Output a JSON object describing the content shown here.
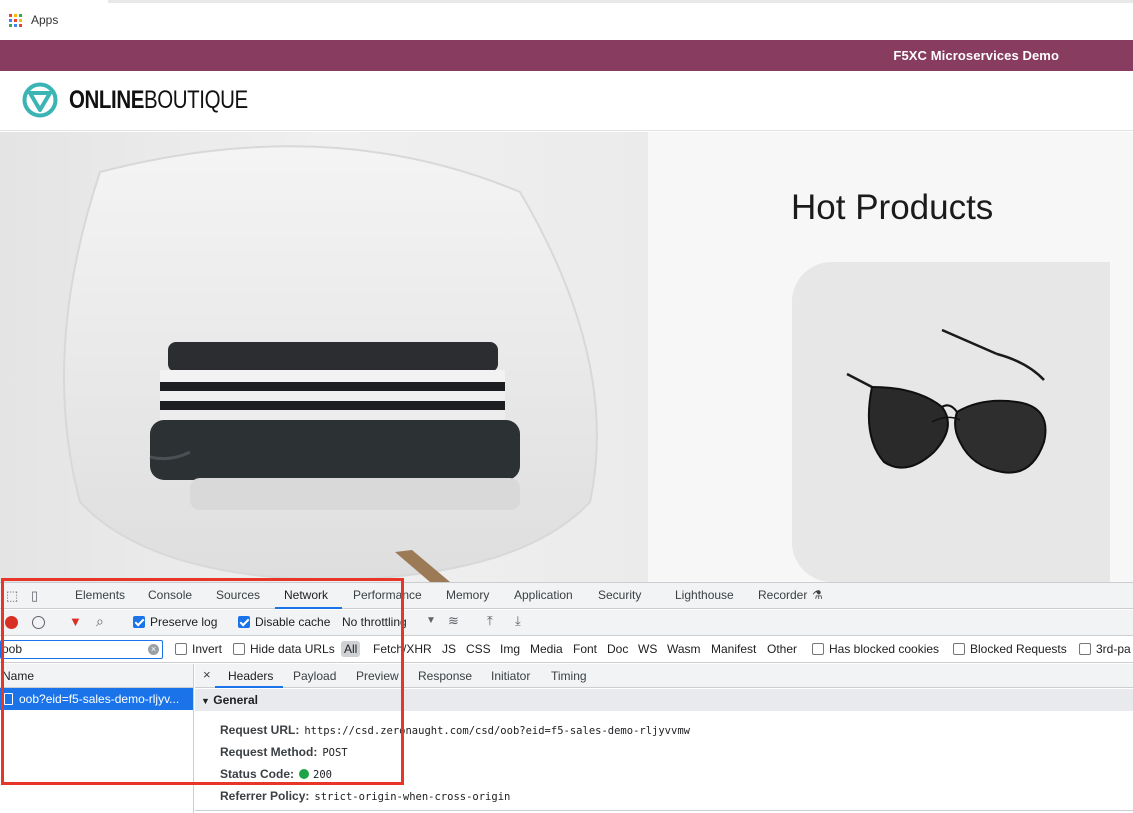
{
  "bookmarks": {
    "apps_label": "Apps"
  },
  "banner": {
    "text": "F5XC Microservices Demo"
  },
  "logo": {
    "bold": "ONLINE",
    "thin": "BOUTIQUE"
  },
  "hot_products": {
    "title": "Hot Products"
  },
  "devtools": {
    "tabs": [
      "Elements",
      "Console",
      "Sources",
      "Network",
      "Performance",
      "Memory",
      "Application",
      "Security",
      "Lighthouse",
      "Recorder"
    ],
    "active_tab": "Network",
    "toolbar": {
      "preserve_log": "Preserve log",
      "disable_cache": "Disable cache",
      "throttling": "No throttling"
    },
    "filter": {
      "value": "oob",
      "invert": "Invert",
      "hide_data_urls": "Hide data URLs",
      "types": [
        "All",
        "Fetch/XHR",
        "JS",
        "CSS",
        "Img",
        "Media",
        "Font",
        "Doc",
        "WS",
        "Wasm",
        "Manifest",
        "Other"
      ],
      "has_blocked_cookies": "Has blocked cookies",
      "blocked_requests": "Blocked Requests",
      "third_party": "3rd-pa"
    },
    "requests": {
      "header": "Name",
      "rows": [
        "oob?eid=f5-sales-demo-rljyv..."
      ]
    },
    "detail": {
      "tabs": [
        "Headers",
        "Payload",
        "Preview",
        "Response",
        "Initiator",
        "Timing"
      ],
      "section": "General",
      "fields": [
        {
          "key": "Request URL:",
          "value": "https://csd.zeronaught.com/csd/oob?eid=f5-sales-demo-rljyvvmw"
        },
        {
          "key": "Request Method:",
          "value": "POST"
        },
        {
          "key": "Status Code:",
          "value": "200"
        },
        {
          "key": "Referrer Policy:",
          "value": "strict-origin-when-cross-origin"
        }
      ]
    }
  },
  "colors": {
    "banner": "#883c60",
    "accent": "#1a73e8",
    "highlight": "#e8352a",
    "logo_teal": "#3bb4b4"
  }
}
